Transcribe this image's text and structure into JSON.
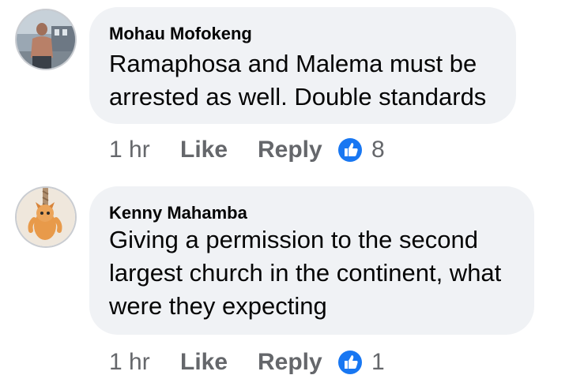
{
  "comments": [
    {
      "author": "Mohau Mofokeng",
      "text": "Ramaphosa and Malema must be\narrested as well. Double standards",
      "time": "1 hr",
      "like_label": "Like",
      "reply_label": "Reply",
      "reaction_count": "8",
      "reaction_icon": "thumbs-up-icon"
    },
    {
      "author": "Kenny Mahamba",
      "text": "Giving a permission to the second\nlargest church in the continent, what\nwere they expecting",
      "time": "1 hr",
      "like_label": "Like",
      "reply_label": "Reply",
      "reaction_count": "1",
      "reaction_icon": "thumbs-up-icon"
    }
  ],
  "colors": {
    "bubble": "#f0f2f5",
    "text": "#050505",
    "muted": "#65676b",
    "like_blue": "#1877f2"
  }
}
